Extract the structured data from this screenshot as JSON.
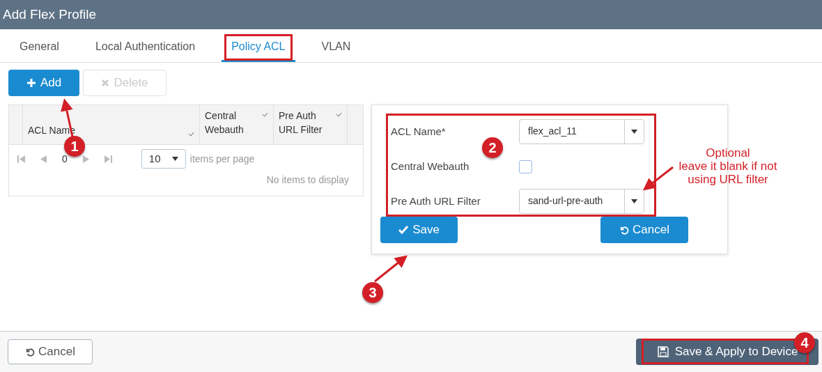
{
  "window": {
    "title": "Add Flex Profile"
  },
  "tabs": [
    {
      "label": "General",
      "selected": false
    },
    {
      "label": "Local Authentication",
      "selected": false
    },
    {
      "label": "Policy ACL",
      "selected": true
    },
    {
      "label": "VLAN",
      "selected": false
    }
  ],
  "toolbar": [
    {
      "kind": "add",
      "label": "Add",
      "disabled": false
    },
    {
      "kind": "delete",
      "label": "Delete",
      "disabled": true
    }
  ],
  "table": {
    "columns": [
      "ACL Name",
      "Central Webauth",
      "Pre Auth URL Filter"
    ],
    "page": "0",
    "page_size": "10",
    "page_size_label": "items per page",
    "empty_message": "No items to display"
  },
  "form": {
    "fields": [
      {
        "kind": "select",
        "label": "ACL Name*",
        "value": "flex_acl_11"
      },
      {
        "kind": "checkbox",
        "label": "Central Webauth",
        "checked": false
      },
      {
        "kind": "select",
        "label": "Pre Auth URL Filter",
        "value": "sand-url-pre-auth"
      }
    ],
    "save": "Save",
    "cancel": "Cancel"
  },
  "footer": {
    "cancel": "Cancel",
    "apply": "Save & Apply to Device"
  },
  "annotations": {
    "markers": [
      "1",
      "2",
      "3",
      "4"
    ],
    "note_lines": [
      "Optional",
      "leave it blank if not",
      "using URL filter"
    ]
  }
}
